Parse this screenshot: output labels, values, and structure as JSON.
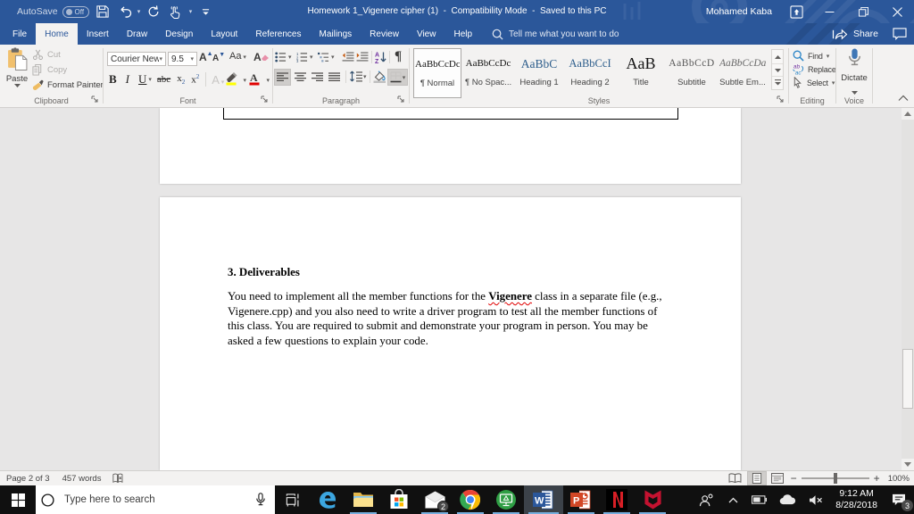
{
  "titlebar": {
    "autosave_label": "AutoSave",
    "autosave_state": "Off",
    "title": "Homework 1_Vigenere cipher (1)  -  Compatibility Mode  -  Saved to this PC",
    "user": "Mohamed Kaba"
  },
  "tabs": {
    "items": [
      {
        "label": "File",
        "active": false
      },
      {
        "label": "Home",
        "active": true
      },
      {
        "label": "Insert",
        "active": false
      },
      {
        "label": "Draw",
        "active": false
      },
      {
        "label": "Design",
        "active": false
      },
      {
        "label": "Layout",
        "active": false
      },
      {
        "label": "References",
        "active": false
      },
      {
        "label": "Mailings",
        "active": false
      },
      {
        "label": "Review",
        "active": false
      },
      {
        "label": "View",
        "active": false
      },
      {
        "label": "Help",
        "active": false
      }
    ],
    "tellme": "Tell me what you want to do",
    "share": "Share"
  },
  "ribbon": {
    "clipboard": {
      "label": "Clipboard",
      "paste": "Paste",
      "cut": "Cut",
      "copy": "Copy",
      "format_painter": "Format Painter"
    },
    "font": {
      "label": "Font",
      "family": "Courier New",
      "size": "9.5",
      "bold": "B",
      "italic": "I",
      "underline": "U",
      "change_case": "Aa",
      "strikethrough": "abc",
      "sub_base": "x",
      "sub_script": "2",
      "sup_base": "x",
      "sup_script": "2",
      "text_effects": "A",
      "grow": "A",
      "shrink": "A",
      "clear": "A"
    },
    "paragraph": {
      "label": "Paragraph",
      "pilcrow": "¶"
    },
    "styles": {
      "label": "Styles",
      "items": [
        {
          "preview": "AaBbCcDc",
          "name": "¶ Normal",
          "kind": "normal",
          "selected": true
        },
        {
          "preview": "AaBbCcDc",
          "name": "¶ No Spac...",
          "kind": "normal",
          "selected": false
        },
        {
          "preview": "AaBbC",
          "name": "Heading 1",
          "kind": "h1",
          "selected": false
        },
        {
          "preview": "AaBbCcI",
          "name": "Heading 2",
          "kind": "h2",
          "selected": false
        },
        {
          "preview": "AaB",
          "name": "Title",
          "kind": "title",
          "selected": false
        },
        {
          "preview": "AaBbCcD",
          "name": "Subtitle",
          "kind": "subtitle",
          "selected": false
        },
        {
          "preview": "AaBbCcDa",
          "name": "Subtle Em...",
          "kind": "subtle",
          "selected": false
        }
      ]
    },
    "editing": {
      "label": "Editing",
      "find": "Find",
      "replace": "Replace",
      "select": "Select"
    },
    "voice": {
      "label": "Voice",
      "dictate": "Dictate"
    }
  },
  "document": {
    "heading": "3. Deliverables",
    "paragraph_lines": [
      [
        {
          "t": "You need to implement all the member functions for the "
        },
        {
          "t": "Vigenere",
          "bold": true,
          "squiggle": true
        },
        {
          "t": " class in a separate file (e.g.,"
        }
      ],
      [
        {
          "t": "Vigenere.cpp) and you also need to write a driver program to test all the member functions of"
        }
      ],
      [
        {
          "t": "this class. You are required to submit and demonstrate your program in person. You may be"
        }
      ],
      [
        {
          "t": "asked a few questions to explain your code."
        }
      ]
    ]
  },
  "statusbar": {
    "page": "Page 2 of 3",
    "words": "457 words",
    "zoom": "100%",
    "zoom_out": "−",
    "zoom_in": "+"
  },
  "taskbar": {
    "search_placeholder": "Type here to search",
    "clock_time": "9:12 AM",
    "clock_date": "8/28/2018",
    "mail_badge": "2",
    "notification_badge": "3",
    "items": [
      "start",
      "search",
      "task-view",
      "edge",
      "file-explorer",
      "store",
      "mail",
      "chrome",
      "screen-share",
      "word",
      "powerpoint",
      "netflix",
      "mcafee"
    ],
    "tray": [
      "people",
      "hidden-icons",
      "battery",
      "onedrive",
      "volume-muted",
      "clock",
      "action-center"
    ]
  }
}
